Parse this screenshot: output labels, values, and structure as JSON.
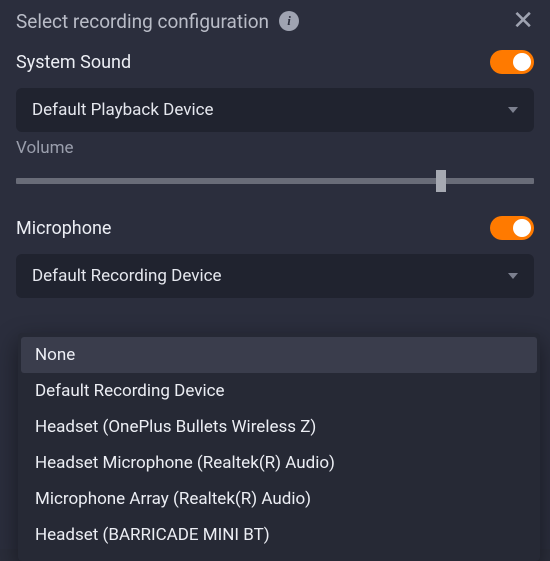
{
  "header": {
    "title": "Select recording configuration"
  },
  "system_sound": {
    "label": "System Sound",
    "toggle": true,
    "device_selected": "Default Playback Device",
    "volume_label": "Volume",
    "volume_percent": 82
  },
  "microphone": {
    "label": "Microphone",
    "toggle": true,
    "device_selected": "Default Recording Device",
    "dropdown_open": true,
    "options": [
      "None",
      "Default Recording Device",
      "Headset (OnePlus Bullets Wireless Z)",
      "Headset Microphone (Realtek(R) Audio)",
      "Microphone Array (Realtek(R) Audio)",
      "Headset (BARRICADE MINI BT)"
    ],
    "highlighted_index": 0
  },
  "colors": {
    "accent": "#ff7a00",
    "panel_bg": "#2b2e3d",
    "select_bg": "#20232f"
  }
}
